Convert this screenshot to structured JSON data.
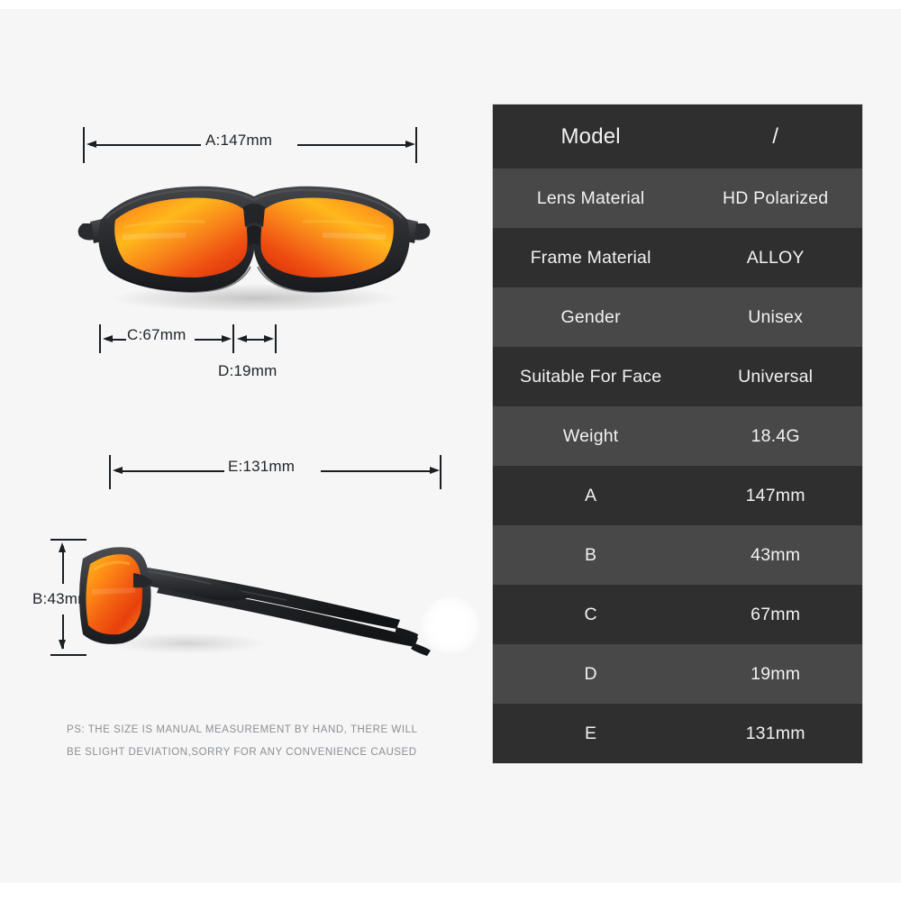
{
  "page": {
    "background_color": "#f6f6f6",
    "outer_color": "#ffffff"
  },
  "dimensions": {
    "a": {
      "label": "A:147mm",
      "value": "147mm",
      "key": "A"
    },
    "b": {
      "label": "B:43mm",
      "value": "43mm",
      "key": "B"
    },
    "c": {
      "label": "C:67mm",
      "value": "67mm",
      "key": "C"
    },
    "d": {
      "label": "D:19mm",
      "value": "19mm",
      "key": "D"
    },
    "e": {
      "label": "E:131mm",
      "value": "131mm",
      "key": "E"
    }
  },
  "disclaimer": {
    "line1": "PS: THE SIZE IS MANUAL MEASUREMENT BY HAND, THERE WILL",
    "line2": "BE SLIGHT DEVIATION,SORRY FOR ANY CONVENIENCE CAUSED"
  },
  "spec_table": {
    "rows": [
      {
        "key": "Model",
        "value": "/"
      },
      {
        "key": "Lens Material",
        "value": "HD Polarized"
      },
      {
        "key": "Frame Material",
        "value": "ALLOY"
      },
      {
        "key": "Gender",
        "value": "Unisex"
      },
      {
        "key": "Suitable For Face",
        "value": "Universal"
      },
      {
        "key": "Weight",
        "value": "18.4G"
      },
      {
        "key": "A",
        "value": "147mm"
      },
      {
        "key": "B",
        "value": "43mm"
      },
      {
        "key": "C",
        "value": "67mm"
      },
      {
        "key": "D",
        "value": "19mm"
      },
      {
        "key": "E",
        "value": "131mm"
      }
    ],
    "row_color_dark": "#2f2f2f",
    "row_color_light": "#484848",
    "text_color": "#f2f2f2"
  },
  "product": {
    "front_view_alt": "sunglasses-front-view",
    "side_view_alt": "sunglasses-side-view",
    "frame_color": "#2b2b2d",
    "lens_color_light": "#ffc21a",
    "lens_color_mid": "#f47a16",
    "lens_color_dark": "#e1300c"
  }
}
